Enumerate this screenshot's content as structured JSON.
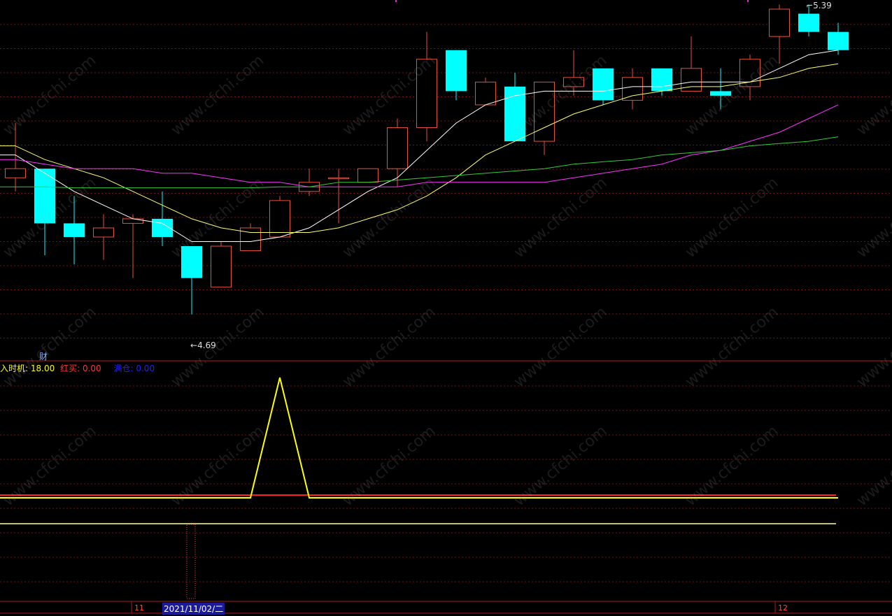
{
  "colors": {
    "background": "#000000",
    "grid": "#7a1010",
    "up": "#e8503a",
    "down": "#00ffff",
    "ma5": "#ffffff",
    "ma10": "#ffff66",
    "ma20": "#ff33ff",
    "ma60": "#33cc33",
    "signal": "#ffff00",
    "red_line": "#ff2020",
    "text": "#cccccc"
  },
  "panel": {
    "cai_label": "财",
    "timing_label": "入时机:",
    "timing_value": "18.00",
    "redbuy_label": "红买:",
    "redbuy_value": "0.00",
    "fullpos_label": "满仓:",
    "fullpos_value": "0.00"
  },
  "axis": {
    "month_11": "11",
    "month_12": "12",
    "cursor_date": "2021/11/02/二"
  },
  "annotations": {
    "high": "5.39",
    "low": "4.69"
  },
  "watermark": "www.cfchi.com",
  "chart_data": [
    {
      "type": "candlestick",
      "title": "",
      "ylim": [
        4.62,
        5.41
      ],
      "candles": [
        {
          "o": 5.02,
          "c": 5.04,
          "h": 5.14,
          "l": 4.99
        },
        {
          "o": 5.04,
          "c": 4.92,
          "h": 5.04,
          "l": 4.85
        },
        {
          "o": 4.92,
          "c": 4.89,
          "h": 4.98,
          "l": 4.83
        },
        {
          "o": 4.89,
          "c": 4.91,
          "h": 4.94,
          "l": 4.84
        },
        {
          "o": 4.92,
          "c": 4.93,
          "h": 4.94,
          "l": 4.8
        },
        {
          "o": 4.93,
          "c": 4.89,
          "h": 4.99,
          "l": 4.87
        },
        {
          "o": 4.87,
          "c": 4.8,
          "h": 4.87,
          "l": 4.72
        },
        {
          "o": 4.78,
          "c": 4.87,
          "h": 4.88,
          "l": 4.78
        },
        {
          "o": 4.86,
          "c": 4.91,
          "h": 4.92,
          "l": 4.86
        },
        {
          "o": 4.89,
          "c": 4.97,
          "h": 4.98,
          "l": 4.89
        },
        {
          "o": 4.99,
          "c": 5.01,
          "h": 5.04,
          "l": 4.98
        },
        {
          "o": 5.02,
          "c": 5.02,
          "h": 5.04,
          "l": 4.92
        },
        {
          "o": 5.01,
          "c": 5.04,
          "h": 5.04,
          "l": 5.01
        },
        {
          "o": 5.04,
          "c": 5.13,
          "h": 5.15,
          "l": 5.0
        },
        {
          "o": 5.13,
          "c": 5.28,
          "h": 5.34,
          "l": 5.1
        },
        {
          "o": 5.3,
          "c": 5.21,
          "h": 5.3,
          "l": 5.19
        },
        {
          "o": 5.18,
          "c": 5.23,
          "h": 5.24,
          "l": 5.18
        },
        {
          "o": 5.22,
          "c": 5.1,
          "h": 5.25,
          "l": 5.1
        },
        {
          "o": 5.1,
          "c": 5.23,
          "h": 5.23,
          "l": 5.07
        },
        {
          "o": 5.22,
          "c": 5.24,
          "h": 5.3,
          "l": 5.2
        },
        {
          "o": 5.26,
          "c": 5.19,
          "h": 5.26,
          "l": 5.18
        },
        {
          "o": 5.19,
          "c": 5.24,
          "h": 5.26,
          "l": 5.17
        },
        {
          "o": 5.26,
          "c": 5.21,
          "h": 5.26,
          "l": 5.2
        },
        {
          "o": 5.21,
          "c": 5.26,
          "h": 5.33,
          "l": 5.21
        },
        {
          "o": 5.21,
          "c": 5.2,
          "h": 5.26,
          "l": 5.17
        },
        {
          "o": 5.22,
          "c": 5.28,
          "h": 5.29,
          "l": 5.19
        },
        {
          "o": 5.33,
          "c": 5.39,
          "h": 5.4,
          "l": 5.27
        },
        {
          "o": 5.38,
          "c": 5.34,
          "h": 5.4,
          "l": 5.33
        },
        {
          "o": 5.34,
          "c": 5.3,
          "h": 5.36,
          "l": 5.29
        }
      ],
      "series": [
        {
          "name": "MA5",
          "values": [
            5.07,
            5.03,
            4.99,
            4.96,
            4.93,
            4.92,
            4.88,
            4.88,
            4.88,
            4.89,
            4.91,
            4.95,
            4.99,
            5.02,
            5.08,
            5.14,
            5.18,
            5.2,
            5.21,
            5.21,
            5.21,
            5.22,
            5.22,
            5.23,
            5.23,
            5.23,
            5.26,
            5.29,
            5.3
          ]
        },
        {
          "name": "MA10",
          "values": [
            5.09,
            5.06,
            5.04,
            5.02,
            4.99,
            4.96,
            4.93,
            4.91,
            4.9,
            4.9,
            4.9,
            4.91,
            4.93,
            4.95,
            4.98,
            5.02,
            5.07,
            5.1,
            5.13,
            5.16,
            5.18,
            5.2,
            5.21,
            5.22,
            5.22,
            5.23,
            5.24,
            5.26,
            5.27
          ]
        },
        {
          "name": "MA20",
          "values": [
            5.06,
            5.05,
            5.04,
            5.04,
            5.04,
            5.03,
            5.03,
            5.02,
            5.01,
            5.01,
            5.0,
            5.0,
            5.0,
            5.0,
            5.01,
            5.01,
            5.01,
            5.01,
            5.01,
            5.02,
            5.03,
            5.04,
            5.05,
            5.07,
            5.08,
            5.1,
            5.12,
            5.15,
            5.18
          ]
        },
        {
          "name": "MA60",
          "values": [
            5.0,
            5.0,
            4.998,
            4.998,
            4.998,
            4.998,
            4.998,
            4.998,
            4.998,
            5.0,
            5.0,
            5.01,
            5.01,
            5.015,
            5.02,
            5.025,
            5.03,
            5.035,
            5.04,
            5.05,
            5.055,
            5.06,
            5.07,
            5.075,
            5.08,
            5.09,
            5.095,
            5.1,
            5.11
          ]
        }
      ]
    },
    {
      "type": "line",
      "title": "",
      "ylim": [
        0,
        20
      ],
      "series": [
        {
          "name": "入时机",
          "values": [
            0,
            0,
            0,
            0,
            0,
            0,
            0,
            0,
            0,
            18,
            0,
            0,
            0,
            0,
            0,
            0,
            0,
            0,
            0,
            0,
            0,
            0,
            0,
            0,
            0,
            0,
            0,
            0,
            0
          ]
        },
        {
          "name": "红买",
          "values": [
            0,
            0,
            0,
            0,
            0,
            0,
            0,
            0,
            0,
            0,
            0,
            0,
            0,
            0,
            0,
            0,
            0,
            0,
            0,
            0,
            0,
            0,
            0,
            0,
            0,
            0,
            0,
            0,
            0
          ]
        }
      ]
    }
  ]
}
